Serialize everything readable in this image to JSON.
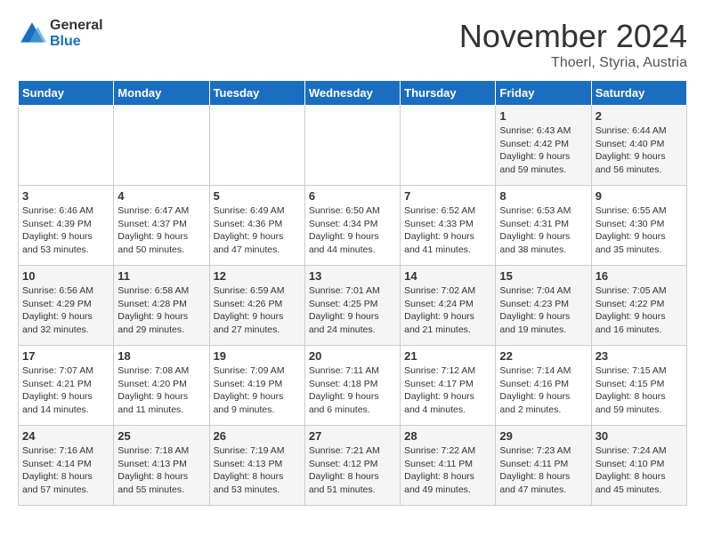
{
  "logo": {
    "line1": "General",
    "line2": "Blue"
  },
  "title": "November 2024",
  "location": "Thoerl, Styria, Austria",
  "weekdays": [
    "Sunday",
    "Monday",
    "Tuesday",
    "Wednesday",
    "Thursday",
    "Friday",
    "Saturday"
  ],
  "weeks": [
    [
      {
        "day": "",
        "info": ""
      },
      {
        "day": "",
        "info": ""
      },
      {
        "day": "",
        "info": ""
      },
      {
        "day": "",
        "info": ""
      },
      {
        "day": "",
        "info": ""
      },
      {
        "day": "1",
        "info": "Sunrise: 6:43 AM\nSunset: 4:42 PM\nDaylight: 9 hours and 59 minutes."
      },
      {
        "day": "2",
        "info": "Sunrise: 6:44 AM\nSunset: 4:40 PM\nDaylight: 9 hours and 56 minutes."
      }
    ],
    [
      {
        "day": "3",
        "info": "Sunrise: 6:46 AM\nSunset: 4:39 PM\nDaylight: 9 hours and 53 minutes."
      },
      {
        "day": "4",
        "info": "Sunrise: 6:47 AM\nSunset: 4:37 PM\nDaylight: 9 hours and 50 minutes."
      },
      {
        "day": "5",
        "info": "Sunrise: 6:49 AM\nSunset: 4:36 PM\nDaylight: 9 hours and 47 minutes."
      },
      {
        "day": "6",
        "info": "Sunrise: 6:50 AM\nSunset: 4:34 PM\nDaylight: 9 hours and 44 minutes."
      },
      {
        "day": "7",
        "info": "Sunrise: 6:52 AM\nSunset: 4:33 PM\nDaylight: 9 hours and 41 minutes."
      },
      {
        "day": "8",
        "info": "Sunrise: 6:53 AM\nSunset: 4:31 PM\nDaylight: 9 hours and 38 minutes."
      },
      {
        "day": "9",
        "info": "Sunrise: 6:55 AM\nSunset: 4:30 PM\nDaylight: 9 hours and 35 minutes."
      }
    ],
    [
      {
        "day": "10",
        "info": "Sunrise: 6:56 AM\nSunset: 4:29 PM\nDaylight: 9 hours and 32 minutes."
      },
      {
        "day": "11",
        "info": "Sunrise: 6:58 AM\nSunset: 4:28 PM\nDaylight: 9 hours and 29 minutes."
      },
      {
        "day": "12",
        "info": "Sunrise: 6:59 AM\nSunset: 4:26 PM\nDaylight: 9 hours and 27 minutes."
      },
      {
        "day": "13",
        "info": "Sunrise: 7:01 AM\nSunset: 4:25 PM\nDaylight: 9 hours and 24 minutes."
      },
      {
        "day": "14",
        "info": "Sunrise: 7:02 AM\nSunset: 4:24 PM\nDaylight: 9 hours and 21 minutes."
      },
      {
        "day": "15",
        "info": "Sunrise: 7:04 AM\nSunset: 4:23 PM\nDaylight: 9 hours and 19 minutes."
      },
      {
        "day": "16",
        "info": "Sunrise: 7:05 AM\nSunset: 4:22 PM\nDaylight: 9 hours and 16 minutes."
      }
    ],
    [
      {
        "day": "17",
        "info": "Sunrise: 7:07 AM\nSunset: 4:21 PM\nDaylight: 9 hours and 14 minutes."
      },
      {
        "day": "18",
        "info": "Sunrise: 7:08 AM\nSunset: 4:20 PM\nDaylight: 9 hours and 11 minutes."
      },
      {
        "day": "19",
        "info": "Sunrise: 7:09 AM\nSunset: 4:19 PM\nDaylight: 9 hours and 9 minutes."
      },
      {
        "day": "20",
        "info": "Sunrise: 7:11 AM\nSunset: 4:18 PM\nDaylight: 9 hours and 6 minutes."
      },
      {
        "day": "21",
        "info": "Sunrise: 7:12 AM\nSunset: 4:17 PM\nDaylight: 9 hours and 4 minutes."
      },
      {
        "day": "22",
        "info": "Sunrise: 7:14 AM\nSunset: 4:16 PM\nDaylight: 9 hours and 2 minutes."
      },
      {
        "day": "23",
        "info": "Sunrise: 7:15 AM\nSunset: 4:15 PM\nDaylight: 8 hours and 59 minutes."
      }
    ],
    [
      {
        "day": "24",
        "info": "Sunrise: 7:16 AM\nSunset: 4:14 PM\nDaylight: 8 hours and 57 minutes."
      },
      {
        "day": "25",
        "info": "Sunrise: 7:18 AM\nSunset: 4:13 PM\nDaylight: 8 hours and 55 minutes."
      },
      {
        "day": "26",
        "info": "Sunrise: 7:19 AM\nSunset: 4:13 PM\nDaylight: 8 hours and 53 minutes."
      },
      {
        "day": "27",
        "info": "Sunrise: 7:21 AM\nSunset: 4:12 PM\nDaylight: 8 hours and 51 minutes."
      },
      {
        "day": "28",
        "info": "Sunrise: 7:22 AM\nSunset: 4:11 PM\nDaylight: 8 hours and 49 minutes."
      },
      {
        "day": "29",
        "info": "Sunrise: 7:23 AM\nSunset: 4:11 PM\nDaylight: 8 hours and 47 minutes."
      },
      {
        "day": "30",
        "info": "Sunrise: 7:24 AM\nSunset: 4:10 PM\nDaylight: 8 hours and 45 minutes."
      }
    ]
  ]
}
